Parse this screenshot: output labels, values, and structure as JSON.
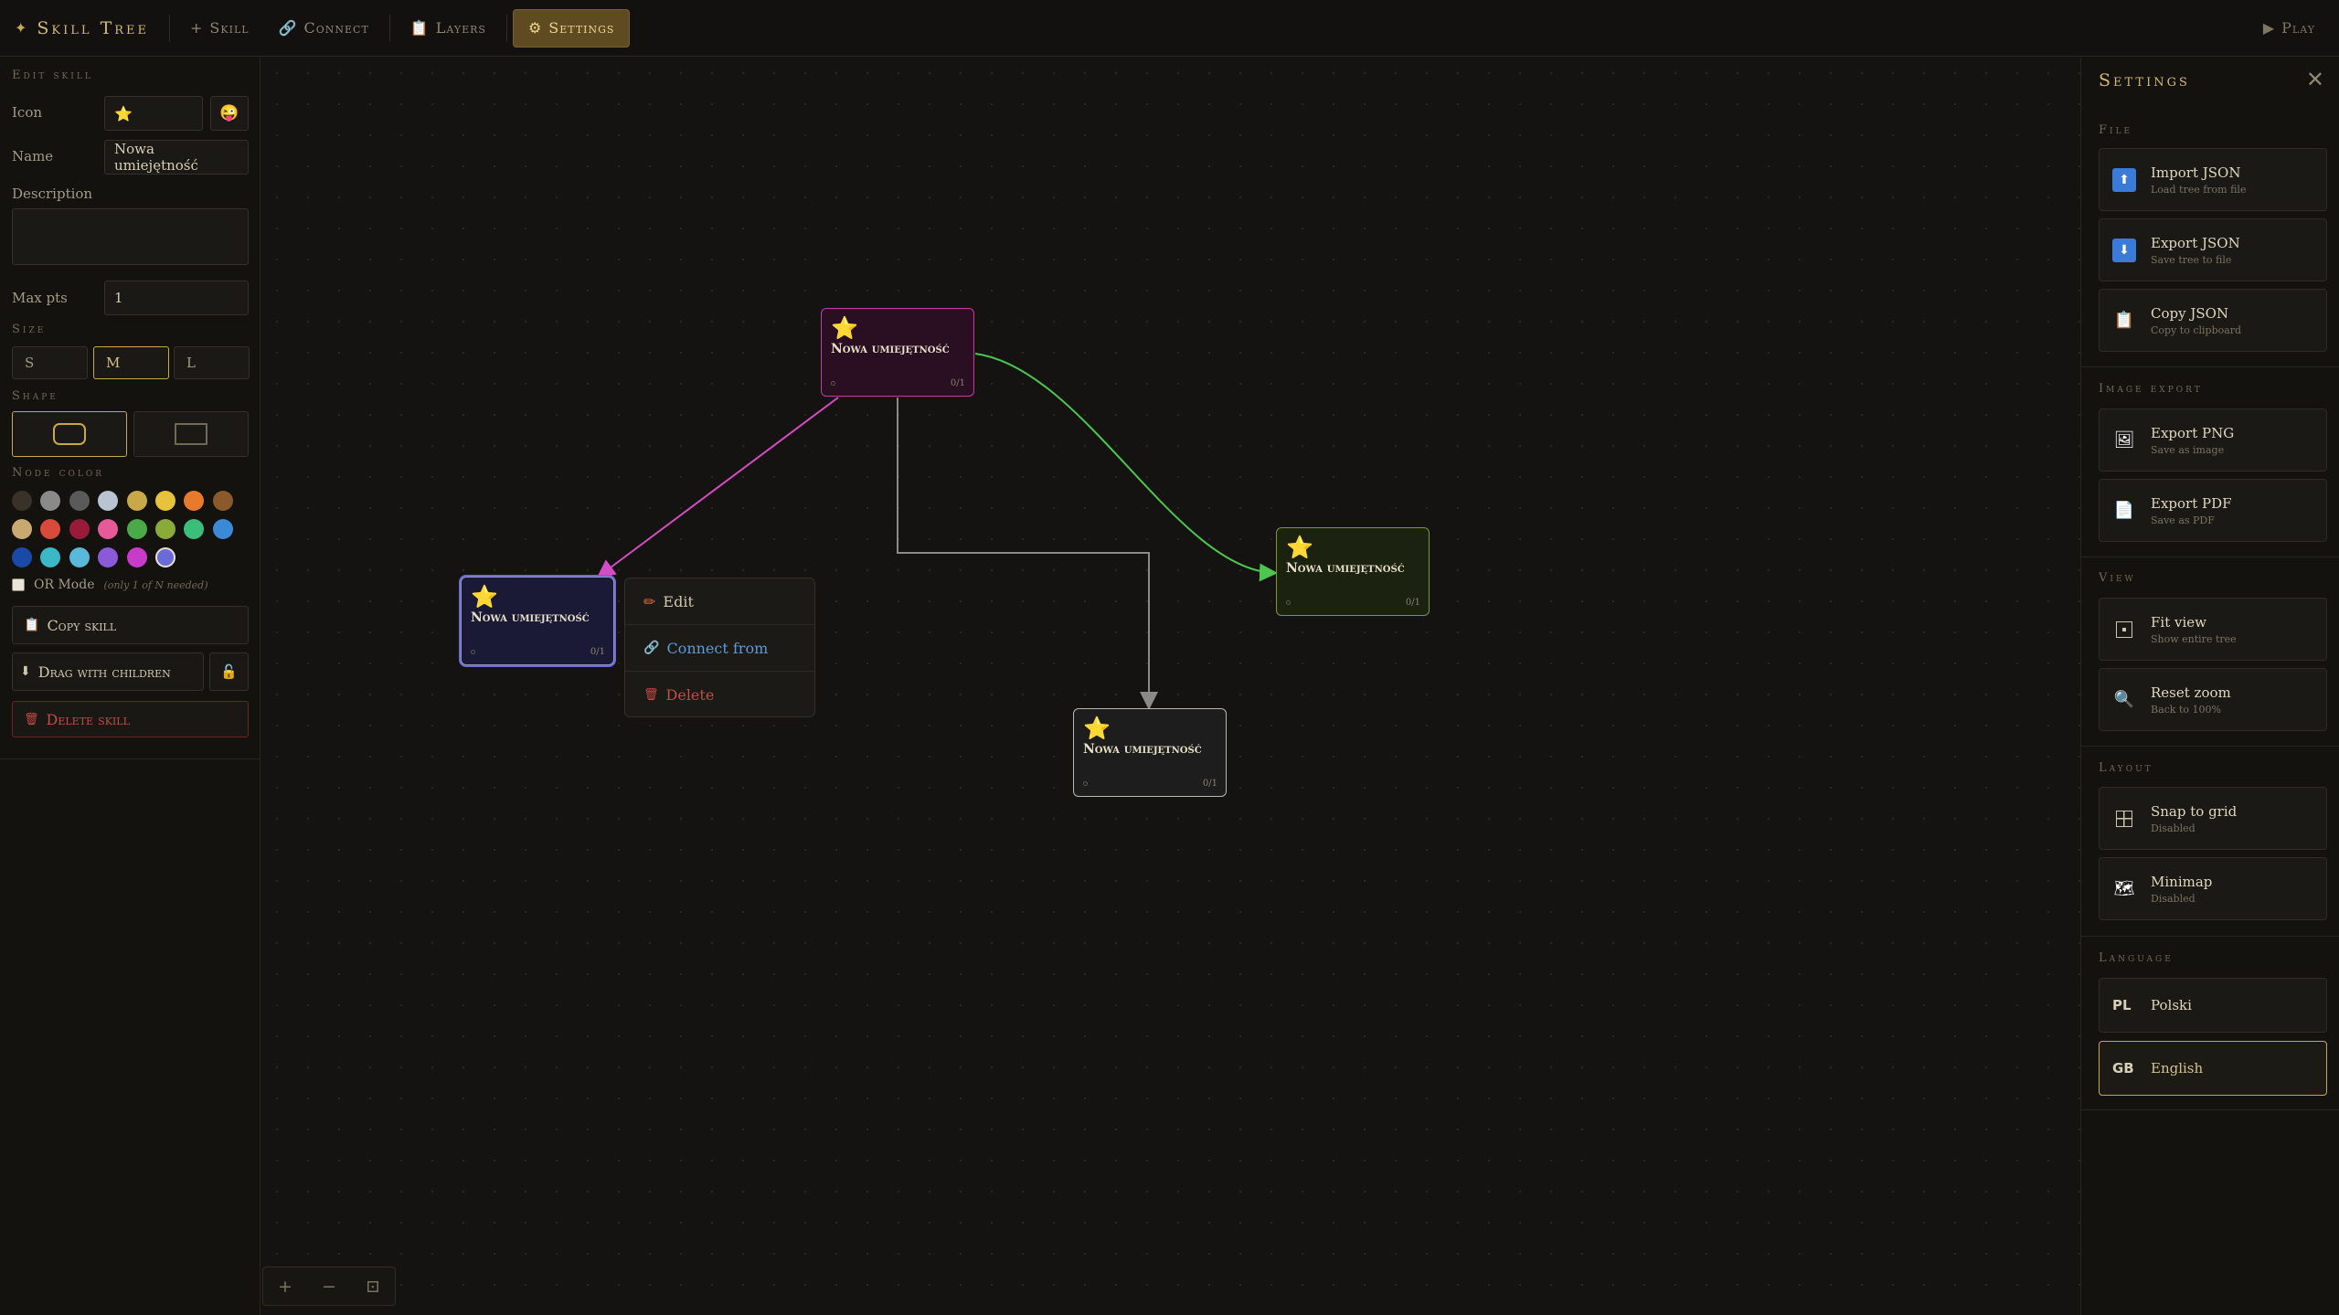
{
  "topbar": {
    "brand": "Skill Tree",
    "skill": "Skill",
    "connect": "Connect",
    "layers": "Layers",
    "settings": "Settings",
    "play": "Play"
  },
  "editor": {
    "section_title": "Edit skill",
    "icon_label": "Icon",
    "icon_value": "⭐",
    "name_label": "Name",
    "name_value": "Nowa umiejętność",
    "description_label": "Description",
    "description_value": "",
    "maxpts_label": "Max pts",
    "maxpts_value": "1",
    "size_title": "Size",
    "sizes": [
      "S",
      "M",
      "L"
    ],
    "selected_size": "M",
    "shape_title": "Shape",
    "node_color_title": "Node color",
    "colors": [
      "#3a3128",
      "#8a8a8a",
      "#5a5a5a",
      "#b8c4d2",
      "#c9a84a",
      "#e6c33a",
      "#e87a2c",
      "#8a5a2c",
      "#c9a871",
      "#d84a3a",
      "#9a1a3a",
      "#e65a9a",
      "#4aaa4a",
      "#8aaa3a",
      "#3abf7a",
      "#3a8ad8",
      "#1a4aa8",
      "#3ab8c8",
      "#5ab8d8",
      "#8a5ad8",
      "#c83ac8",
      "#6a6ad8"
    ],
    "selected_color": 21,
    "or_mode_label": "OR Mode",
    "or_mode_hint": "(only 1 of N needed)",
    "copy_skill": "Copy skill",
    "drag_children": "Drag with children",
    "delete_skill": "Delete skill"
  },
  "nodes": [
    {
      "icon": "⭐",
      "title": "Nowa umiejętność",
      "points": "0/1"
    },
    {
      "icon": "⭐",
      "title": "Nowa umiejętność",
      "points": "0/1"
    },
    {
      "icon": "⭐",
      "title": "Nowa umiejętność",
      "points": "0/1"
    },
    {
      "icon": "⭐",
      "title": "Nowa umiejętność",
      "points": "0/1"
    }
  ],
  "context_menu": {
    "edit": "Edit",
    "connect_from": "Connect from",
    "delete": "Delete"
  },
  "zoom": {
    "plus": "+",
    "minus": "−",
    "fit": "⊡"
  },
  "settings": {
    "title": "Settings",
    "file_title": "File",
    "import_json": "Import JSON",
    "import_json_sub": "Load tree from file",
    "export_json": "Export JSON",
    "export_json_sub": "Save tree to file",
    "copy_json": "Copy JSON",
    "copy_json_sub": "Copy to clipboard",
    "image_title": "Image export",
    "export_png": "Export PNG",
    "export_png_sub": "Save as image",
    "export_pdf": "Export PDF",
    "export_pdf_sub": "Save as PDF",
    "view_title": "View",
    "fit_view": "Fit view",
    "fit_view_sub": "Show entire tree",
    "reset_zoom": "Reset zoom",
    "reset_zoom_sub": "Back to 100%",
    "layout_title": "Layout",
    "snap_grid": "Snap to grid",
    "snap_grid_sub": "Disabled",
    "minimap": "Minimap",
    "minimap_sub": "Disabled",
    "language_title": "Language",
    "pl_code": "PL",
    "pl_label": "Polski",
    "gb_code": "GB",
    "gb_label": "English"
  }
}
